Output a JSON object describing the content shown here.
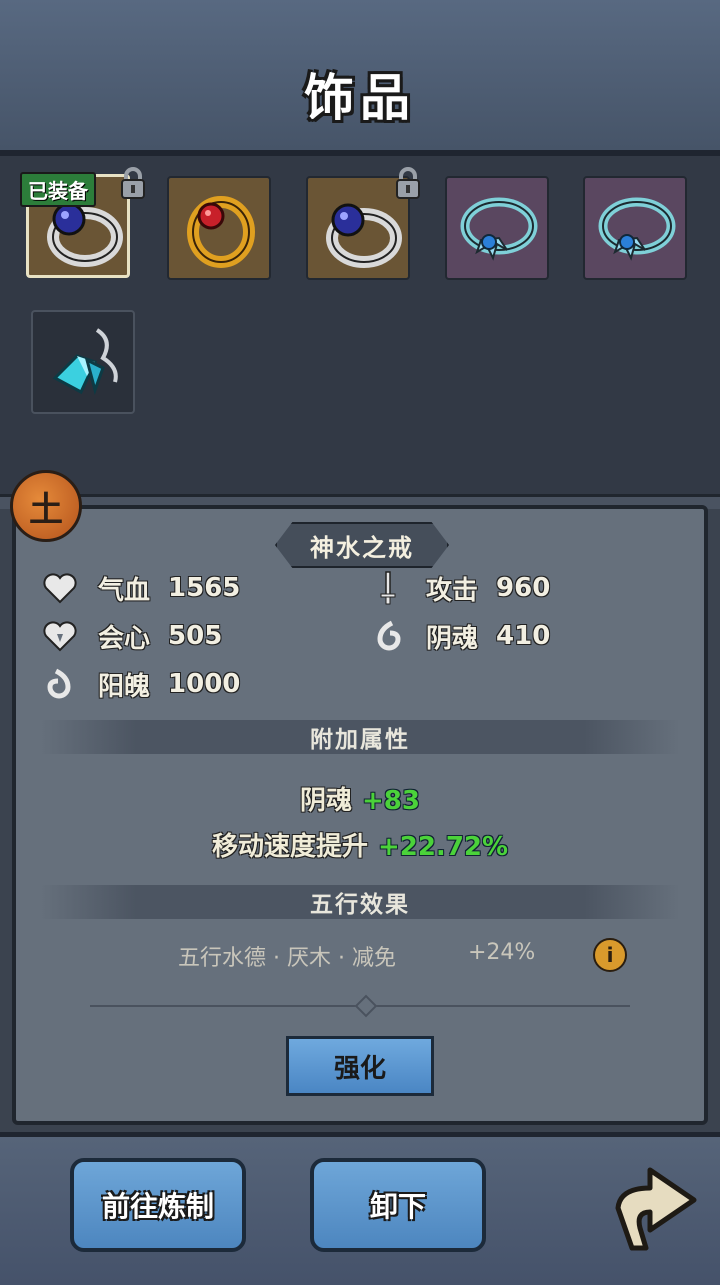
{
  "header": {
    "title": "饰品"
  },
  "inventory": {
    "equipped_badge": "已装备",
    "slots": [
      {
        "name": "silver-sapphire-ring",
        "icon": "ring-icon",
        "rarity": "gold",
        "selected": true,
        "locked": true
      },
      {
        "name": "gold-ruby-ring",
        "icon": "ring-icon",
        "rarity": "gold",
        "selected": false,
        "locked": false
      },
      {
        "name": "silver-sapphire-ring",
        "icon": "ring-icon",
        "rarity": "gold",
        "selected": false,
        "locked": true
      },
      {
        "name": "azure-crystal-ring",
        "icon": "ring-icon",
        "rarity": "purple",
        "selected": false,
        "locked": false
      },
      {
        "name": "azure-crystal-ring",
        "icon": "ring-icon",
        "rarity": "purple",
        "selected": false,
        "locked": false
      },
      {
        "name": "crystal-pendant",
        "icon": "pendant-icon",
        "rarity": "dark",
        "selected": false,
        "locked": false
      }
    ]
  },
  "element": {
    "glyph": "土",
    "color": "#e58a3a"
  },
  "item": {
    "name": "神水之戒",
    "stats": [
      {
        "label": "气血",
        "value": "1565",
        "icon": "heart-icon"
      },
      {
        "label": "攻击",
        "value": "960",
        "icon": "sword-icon"
      },
      {
        "label": "会心",
        "value": "505",
        "icon": "crit-heart-icon"
      },
      {
        "label": "阴魂",
        "value": "410",
        "icon": "yin-soul-icon"
      },
      {
        "label": "阳魄",
        "value": "1000",
        "icon": "yang-soul-icon"
      }
    ]
  },
  "extra": {
    "title": "附加属性",
    "lines": [
      {
        "label": "阴魂",
        "value": "+83"
      },
      {
        "label": "移动速度提升",
        "value": "+22.72%"
      }
    ],
    "value_color": "#4bd23a"
  },
  "wuxing": {
    "title": "五行效果",
    "text": "五行水德 · 厌木 · 减免",
    "value": "+24%",
    "info_glyph": "i"
  },
  "buttons": {
    "enhance": "强化",
    "refine": "前往炼制",
    "unequip": "卸下"
  },
  "colors": {
    "accent_blue": "#5a96d0",
    "panel": "#66707c",
    "background": "#3b434f"
  }
}
